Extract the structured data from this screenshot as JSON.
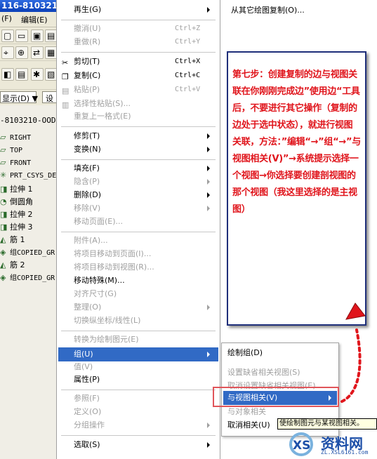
{
  "app": {
    "title_fragment": "116-810321",
    "menu_bar": [
      "(F)",
      "编辑(E)"
    ],
    "display_button": "显示(D) ▼",
    "settings_button": "设",
    "model_tree": {
      "root": "-8103210-OOD.",
      "items": [
        {
          "icon": "datum-plane-icon",
          "label": "RIGHT"
        },
        {
          "icon": "datum-plane-icon",
          "label": "TOP"
        },
        {
          "icon": "datum-plane-icon",
          "label": "FRONT"
        },
        {
          "icon": "csys-icon",
          "label": "PRT_CSYS_DE"
        },
        {
          "icon": "extrude-icon",
          "label": "拉伸 1"
        },
        {
          "icon": "round-icon",
          "label": "倒圆角"
        },
        {
          "icon": "extrude-icon",
          "label": "拉伸 2"
        },
        {
          "icon": "extrude-icon",
          "label": "拉伸 3"
        },
        {
          "icon": "rib-icon",
          "label": "筋 1"
        },
        {
          "icon": "group-icon",
          "label": "组COPIED_GR"
        },
        {
          "icon": "rib-icon",
          "label": "筋 2"
        },
        {
          "icon": "group-icon",
          "label": "组COPIED_GR"
        }
      ]
    }
  },
  "context_menu": {
    "items": [
      {
        "label": "再生(G)",
        "shortcut": "",
        "disabled": false,
        "submenu": true,
        "icon": ""
      },
      {
        "label": "撤消(U)",
        "shortcut": "Ctrl+Z",
        "disabled": true,
        "submenu": false,
        "icon": ""
      },
      {
        "label": "重做(R)",
        "shortcut": "Ctrl+Y",
        "disabled": true,
        "submenu": false,
        "icon": ""
      },
      {
        "label": "剪切(T)",
        "shortcut": "Ctrl+X",
        "disabled": false,
        "submenu": false,
        "icon": "scissors-icon"
      },
      {
        "label": "复制(C)",
        "shortcut": "Ctrl+C",
        "disabled": false,
        "submenu": false,
        "icon": "copy-icon"
      },
      {
        "label": "粘贴(P)",
        "shortcut": "Ctrl+V",
        "disabled": true,
        "submenu": false,
        "icon": "paste-icon"
      },
      {
        "label": "选择性粘贴(S)...",
        "shortcut": "",
        "disabled": true,
        "submenu": false,
        "icon": "paste-special-icon"
      },
      {
        "label": "重复上一格式(E)",
        "shortcut": "",
        "disabled": true,
        "submenu": false,
        "icon": ""
      },
      {
        "label": "修剪(T)",
        "shortcut": "",
        "disabled": false,
        "submenu": true,
        "icon": ""
      },
      {
        "label": "变换(N)",
        "shortcut": "",
        "disabled": false,
        "submenu": true,
        "icon": ""
      },
      {
        "label": "填充(F)",
        "shortcut": "",
        "disabled": false,
        "submenu": true,
        "icon": ""
      },
      {
        "label": "隐含(P)",
        "shortcut": "",
        "disabled": true,
        "submenu": true,
        "icon": ""
      },
      {
        "label": "删除(D)",
        "shortcut": "",
        "disabled": false,
        "submenu": true,
        "icon": ""
      },
      {
        "label": "移除(V)",
        "shortcut": "",
        "disabled": true,
        "submenu": true,
        "icon": ""
      },
      {
        "label": "移动页面(E)...",
        "shortcut": "",
        "disabled": true,
        "submenu": false,
        "icon": ""
      },
      {
        "label": "附件(A)...",
        "shortcut": "",
        "disabled": true,
        "submenu": false,
        "icon": ""
      },
      {
        "label": "将项目移动到页面(I)...",
        "shortcut": "",
        "disabled": true,
        "submenu": false,
        "icon": ""
      },
      {
        "label": "将项目移动到视图(R)...",
        "shortcut": "",
        "disabled": true,
        "submenu": false,
        "icon": ""
      },
      {
        "label": "移动特殊(M)...",
        "shortcut": "",
        "disabled": false,
        "submenu": false,
        "icon": ""
      },
      {
        "label": "对齐尺寸(G)",
        "shortcut": "",
        "disabled": true,
        "submenu": false,
        "icon": ""
      },
      {
        "label": "整理(O)",
        "shortcut": "",
        "disabled": true,
        "submenu": true,
        "icon": ""
      },
      {
        "label": "切换纵坐标/线性(L)",
        "shortcut": "",
        "disabled": true,
        "submenu": false,
        "icon": ""
      },
      {
        "label": "转换为绘制图元(E)",
        "shortcut": "",
        "disabled": true,
        "submenu": false,
        "icon": ""
      },
      {
        "label": "组(U)",
        "shortcut": "",
        "disabled": false,
        "submenu": true,
        "icon": "",
        "highlighted": true
      },
      {
        "label": "值(V)",
        "shortcut": "",
        "disabled": true,
        "submenu": false,
        "icon": ""
      },
      {
        "label": "属性(P)",
        "shortcut": "",
        "disabled": false,
        "submenu": false,
        "icon": ""
      },
      {
        "label": "参照(F)",
        "shortcut": "",
        "disabled": true,
        "submenu": false,
        "icon": ""
      },
      {
        "label": "定义(O)",
        "shortcut": "",
        "disabled": true,
        "submenu": false,
        "icon": ""
      },
      {
        "label": "分组操作",
        "shortcut": "",
        "disabled": true,
        "submenu": true,
        "icon": ""
      },
      {
        "label": "选取(S)",
        "shortcut": "",
        "disabled": false,
        "submenu": true,
        "icon": ""
      }
    ]
  },
  "copy_submenu": {
    "label": "从其它绘图复制(O)..."
  },
  "group_submenu": {
    "items": [
      {
        "label": "绘制组(D)",
        "disabled": false,
        "highlighted": false
      },
      {
        "label": "设置缺省相关视图(S)",
        "disabled": true,
        "highlighted": false
      },
      {
        "label": "取消设置缺省相关视图(E)",
        "disabled": true,
        "highlighted": false
      },
      {
        "label": "与视图相关(V)",
        "disabled": false,
        "highlighted": true
      },
      {
        "label": "与对象相关",
        "disabled": true,
        "highlighted": false
      },
      {
        "label": "取消相关(U)",
        "disabled": false,
        "highlighted": false
      }
    ]
  },
  "tooltip": "使绘制图元与某视图相关。",
  "annotation": {
    "text": "第七步：创建复制的边与视图关联在你刚刚完成边”使用边“工具后，不要进行其它操作（复制的边处于选中状态），就进行视图关联，方法：”编辑“→”组“→”与视图相关(V)”→系统提示选择一个视图→你选择要创建剖视图的那个视图（我这里选择的是主视图）"
  },
  "watermark": {
    "site": "资料网",
    "url": "ZL.XSL6161.com"
  },
  "colors": {
    "annotation_text": "#e0151c",
    "highlight": "#316ac5",
    "annotation_border": "#1f2f7a"
  }
}
